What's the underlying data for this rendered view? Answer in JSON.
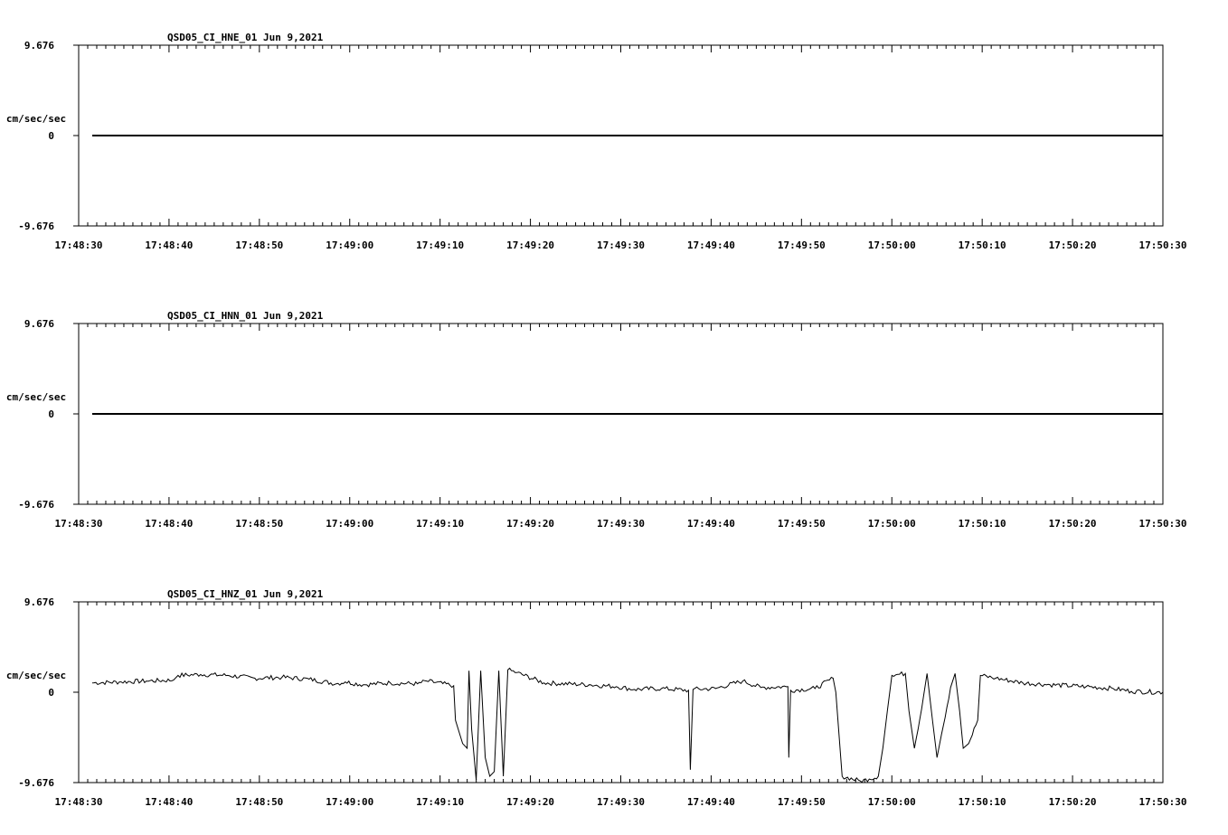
{
  "chart_data": [
    {
      "type": "line",
      "title": "QSD05_CI_HNE_01",
      "date": "Jun 9,2021",
      "ylabel": "cm/sec/sec",
      "ylim": [
        -9.676,
        9.676
      ],
      "y_ticks": [
        "9.676",
        "0",
        "-9.676"
      ],
      "x_ticks": [
        "17:48:30",
        "17:48:40",
        "17:48:50",
        "17:49:00",
        "17:49:10",
        "17:49:20",
        "17:49:30",
        "17:49:40",
        "17:49:50",
        "17:50:00",
        "17:50:10",
        "17:50:20",
        "17:50:30"
      ],
      "series": [
        {
          "x_start": "17:48:31.5",
          "x_end": "17:50:30",
          "values": [
            [
              0,
              0
            ],
            [
              118.5,
              0
            ]
          ]
        }
      ]
    },
    {
      "type": "line",
      "title": "QSD05_CI_HNN_01",
      "date": "Jun 9,2021",
      "ylabel": "cm/sec/sec",
      "ylim": [
        -9.676,
        9.676
      ],
      "y_ticks": [
        "9.676",
        "0",
        "-9.676"
      ],
      "x_ticks": [
        "17:48:30",
        "17:48:40",
        "17:48:50",
        "17:49:00",
        "17:49:10",
        "17:49:20",
        "17:49:30",
        "17:49:40",
        "17:49:50",
        "17:50:00",
        "17:50:10",
        "17:50:20",
        "17:50:30"
      ],
      "series": [
        {
          "x_start": "17:48:31.5",
          "x_end": "17:50:30",
          "values": [
            [
              0,
              0
            ],
            [
              118.5,
              0
            ]
          ]
        }
      ]
    },
    {
      "type": "line",
      "title": "QSD05_CI_HNZ_01",
      "date": "Jun 9,2021",
      "ylabel": "cm/sec/sec",
      "ylim": [
        -9.676,
        9.676
      ],
      "y_ticks": [
        "9.676",
        "0",
        "-9.676"
      ],
      "x_ticks": [
        "17:48:30",
        "17:48:40",
        "17:48:50",
        "17:49:00",
        "17:49:10",
        "17:49:20",
        "17:49:30",
        "17:49:40",
        "17:49:50",
        "17:50:00",
        "17:50:10",
        "17:50:20",
        "17:50:30"
      ],
      "series": [
        {
          "x_start": "17:48:31.5",
          "x_end": "17:50:30",
          "values": [
            [
              0,
              1.0
            ],
            [
              3,
              1.1
            ],
            [
              6,
              1.2
            ],
            [
              9,
              1.3
            ],
            [
              9.5,
              1.8
            ],
            [
              12,
              1.9
            ],
            [
              15,
              1.8
            ],
            [
              18,
              1.5
            ],
            [
              21,
              1.6
            ],
            [
              24,
              1.4
            ],
            [
              27,
              0.9
            ],
            [
              28,
              1.1
            ],
            [
              30,
              0.8
            ],
            [
              33,
              1.0
            ],
            [
              36,
              0.9
            ],
            [
              37,
              1.2
            ],
            [
              40,
              0.7
            ],
            [
              40.2,
              -3.0
            ],
            [
              41,
              -5.5
            ],
            [
              41.5,
              -6.0
            ],
            [
              41.7,
              2.3
            ],
            [
              42,
              -4.0
            ],
            [
              42.5,
              -9.4
            ],
            [
              43,
              2.3
            ],
            [
              43.5,
              -7.0
            ],
            [
              44,
              -9.0
            ],
            [
              44.5,
              -8.5
            ],
            [
              45,
              2.3
            ],
            [
              45.5,
              -9.0
            ],
            [
              46,
              2.4
            ],
            [
              47,
              2.1
            ],
            [
              50,
              1.0
            ],
            [
              55,
              0.8
            ],
            [
              58,
              0.6
            ],
            [
              60,
              0.3
            ],
            [
              63,
              0.4
            ],
            [
              66,
              0.2
            ],
            [
              66.2,
              -8.3
            ],
            [
              66.5,
              0.3
            ],
            [
              69,
              0.4
            ],
            [
              72,
              1.2
            ],
            [
              74,
              0.5
            ],
            [
              77,
              0.6
            ],
            [
              77.1,
              -7.0
            ],
            [
              77.3,
              0.2
            ],
            [
              80,
              0.4
            ],
            [
              82,
              1.5
            ],
            [
              82.3,
              0.0
            ],
            [
              83,
              -9.0
            ],
            [
              85,
              -9.5
            ],
            [
              86,
              -9.3
            ],
            [
              87,
              -9.0
            ],
            [
              87.5,
              -6.0
            ],
            [
              88,
              -2.0
            ],
            [
              88.5,
              1.8
            ],
            [
              90,
              2.0
            ],
            [
              90.4,
              -2.0
            ],
            [
              91,
              -6.0
            ],
            [
              92,
              -0.5
            ],
            [
              92.4,
              2.0
            ],
            [
              93,
              -3.0
            ],
            [
              93.5,
              -7.0
            ],
            [
              94,
              -4.5
            ],
            [
              95,
              0.5
            ],
            [
              95.5,
              2.0
            ],
            [
              96,
              -2.0
            ],
            [
              96.4,
              -6.0
            ],
            [
              97,
              -5.5
            ],
            [
              98,
              -3.0
            ],
            [
              98.3,
              1.8
            ],
            [
              100,
              1.5
            ],
            [
              103,
              1.0
            ],
            [
              106,
              0.8
            ],
            [
              110,
              0.6
            ],
            [
              113,
              0.4
            ],
            [
              115,
              0.1
            ],
            [
              118.5,
              0.0
            ]
          ]
        }
      ]
    }
  ]
}
